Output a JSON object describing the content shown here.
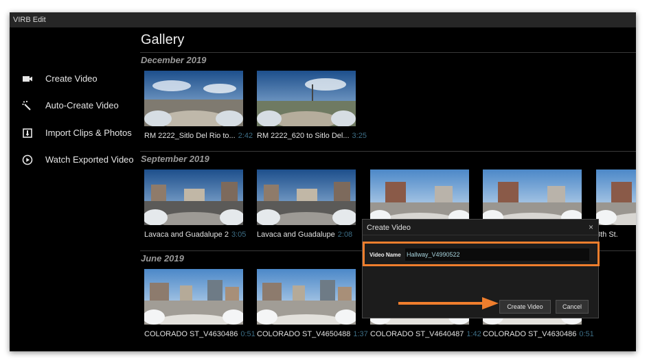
{
  "app": {
    "title": "VIRB Edit"
  },
  "sidebar": {
    "items": [
      {
        "label": "Create Video",
        "icon": "camera-icon"
      },
      {
        "label": "Auto-Create Video",
        "icon": "magic-wand-icon"
      },
      {
        "label": "Import Clips & Photos",
        "icon": "import-icon"
      },
      {
        "label": "Watch Exported Video",
        "icon": "play-icon"
      }
    ]
  },
  "gallery": {
    "title": "Gallery",
    "sections": [
      {
        "heading": "December 2019",
        "clips": [
          {
            "name": "RM 2222_Sitlo Del Rio to...",
            "duration": "2:42"
          },
          {
            "name": "RM 2222_620 to Sitlo Del...",
            "duration": "3:25"
          }
        ]
      },
      {
        "heading": "September 2019",
        "clips": [
          {
            "name": "Lavaca and Guadalupe 2",
            "duration": "3:05"
          },
          {
            "name": "Lavaca and Guadalupe",
            "duration": "2:08"
          },
          {
            "name": "",
            "duration": ""
          },
          {
            "name": "",
            "duration": ""
          },
          {
            "name": "8th St.",
            "duration": ""
          }
        ]
      },
      {
        "heading": "June 2019",
        "clips": [
          {
            "name": "COLORADO ST_V4630486",
            "duration": "0:51"
          },
          {
            "name": "COLORADO ST_V4650488",
            "duration": "1:37"
          },
          {
            "name": "COLORADO ST_V4640487",
            "duration": "1:42"
          },
          {
            "name": "COLORADO ST_V4630486",
            "duration": "0:51"
          }
        ]
      }
    ]
  },
  "dialog": {
    "title": "Create Video",
    "close": "×",
    "field_label": "Video Name",
    "field_value": "Hallway_V4990522",
    "create_button": "Create Video",
    "cancel_button": "Cancel",
    "highlight_color": "#ef7e2d"
  }
}
